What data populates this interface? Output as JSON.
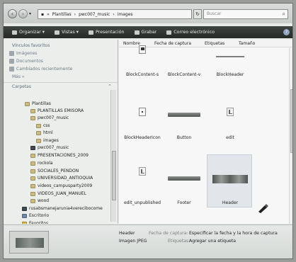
{
  "address": {
    "segments": [
      "Plantillas",
      "pwc007_music",
      "images"
    ],
    "search_placeholder": "Buscar"
  },
  "toolbar": {
    "organize": "Organizar",
    "views": "Vistas",
    "slideshow": "Presentación",
    "burn": "Grabar",
    "email": "Correo electrónico"
  },
  "sidebar": {
    "favorites_header": "Vínculos favoritos",
    "favorites": [
      "Imágenes",
      "Documentos",
      "Cambiados recientemente"
    ],
    "more": "Más",
    "folders_header": "Carpetas",
    "tree": [
      "Plantillas",
      "PLANTILLAS EMISORA",
      "pwc007_music",
      "css",
      "html",
      "images",
      "pwc007_music",
      "PRESENTACIONES_2009",
      "rockola",
      "SOCIALES_PENDON",
      "UNIVERSIDAD_ANTIOQUIA",
      "videos_campusparty2009",
      "VIDEOS_JUAN_MANUEL",
      "wood",
      "rusabsmanejarunia4verecibocome",
      "Escritorio",
      "Favoritos"
    ]
  },
  "columns": {
    "name": "Nombre",
    "date": "Fecha de captura",
    "tags": "Etiquetas",
    "size": "Tamaño"
  },
  "files": [
    "BlockContent-s",
    "BlockContent-v",
    "BlockHeader",
    "BlockHeaderIcon",
    "Button",
    "edit",
    "edit_unpublished",
    "Footer",
    "Header"
  ],
  "details": {
    "name": "Header",
    "type": "Imagen JPEG",
    "date_label": "Fecha de captura:",
    "date_value": "Especificar la fecha y la hora de captura",
    "tags_label": "Etiquetas:",
    "tags_value": "Agregar una etiqueta"
  }
}
